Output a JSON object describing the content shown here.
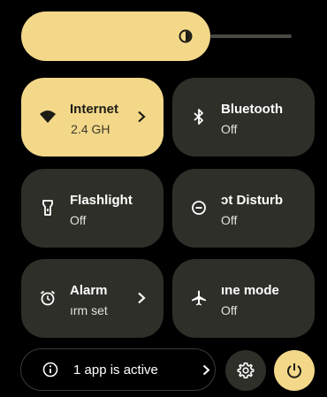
{
  "brightness": {
    "level": 0.62,
    "icon": "brightness-icon"
  },
  "tiles": [
    {
      "title": "Internet",
      "subtitle": " 2.4 GH",
      "icon": "wifi-icon",
      "active": true,
      "has_chevron": true
    },
    {
      "title": "Bluetooth",
      "subtitle": "Off",
      "icon": "bluetooth-icon",
      "active": false,
      "has_chevron": false
    },
    {
      "title": "Flashlight",
      "subtitle": "Off",
      "icon": "flashlight-icon",
      "active": false,
      "has_chevron": false
    },
    {
      "title": "ɔt Disturb",
      "subtitle": "Off",
      "icon": "do-not-disturb-icon",
      "active": false,
      "has_chevron": false
    },
    {
      "title": "Alarm",
      "subtitle": "ırm set",
      "icon": "alarm-icon",
      "active": false,
      "has_chevron": true
    },
    {
      "title": "ıne mode",
      "subtitle": "Off",
      "icon": "airplane-icon",
      "active": false,
      "has_chevron": false
    }
  ],
  "footer": {
    "active_apps_label": "1 app is active",
    "info_icon": "info-icon",
    "settings_icon": "gear-icon",
    "power_icon": "power-icon"
  },
  "colors": {
    "accent": "#f3d88a",
    "tile_inactive": "#2f2f2a",
    "background": "#000000"
  }
}
